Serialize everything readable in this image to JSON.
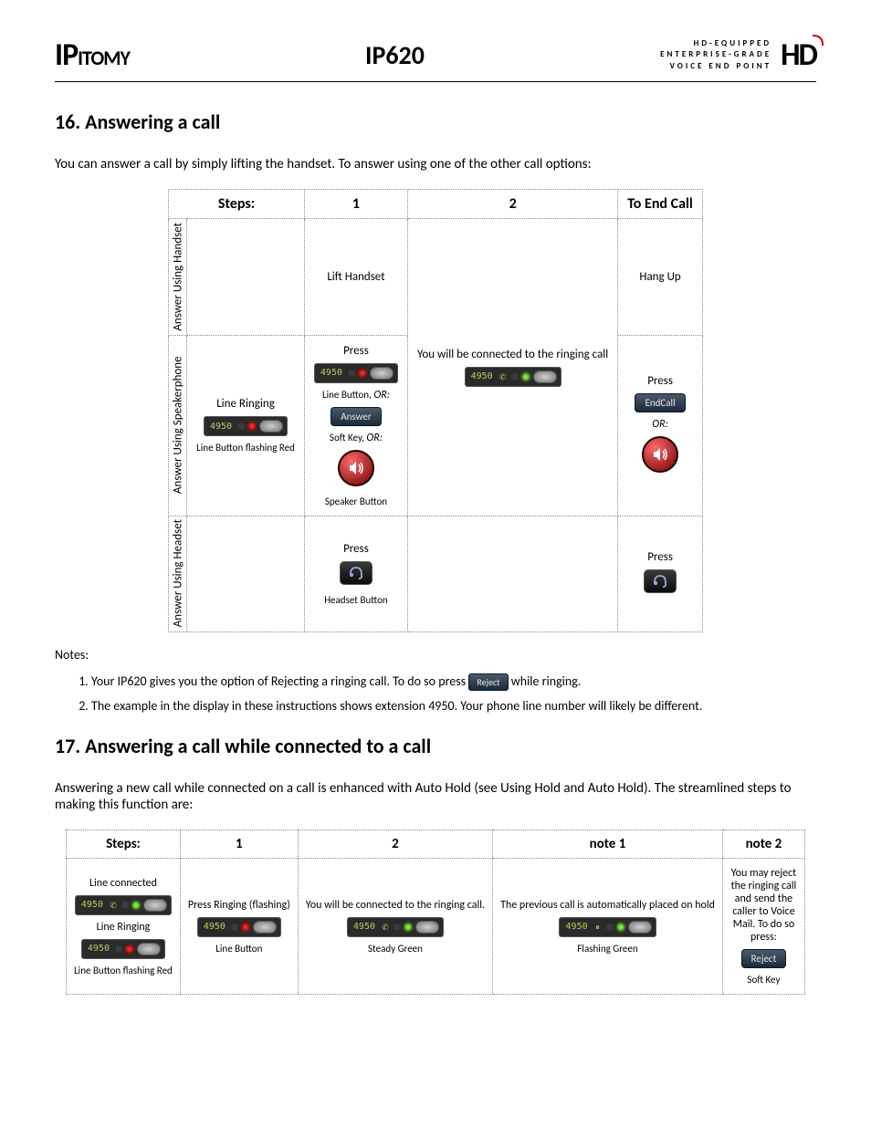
{
  "header": {
    "logo_left": "IPITOMY",
    "model": "IP620",
    "tagline_l1": "HD-EQUIPPED",
    "tagline_l2": "ENTERPRISE-GRADE",
    "tagline_l3": "VOICE END POINT",
    "logo_right": "HD"
  },
  "section16": {
    "heading": "16. Answering a call",
    "intro": "You can answer a call by simply lifting the handset. To answer using one of the other call options:",
    "table": {
      "col_steps": "Steps:",
      "col_1": "1",
      "col_2": "2",
      "col_end": "To End Call",
      "row_handset_label": "Answer Using Handset",
      "row_speaker_label": "Answer Using Speakerphone",
      "row_headset_label": "Answer Using Headset",
      "handset_s1": "Lift Handset",
      "handset_end": "Hang Up",
      "speaker_steps_title": "Line Ringing",
      "ext_num": "4950",
      "line_flashing_red": "Line Button flashing Red",
      "press": "Press",
      "line_button_or": "Line Button,",
      "or": "OR:",
      "answer_key": "Answer",
      "softkey_or": "Soft Key,",
      "speaker_button": "Speaker Button",
      "connected_text": "You will be connected to the ringing call",
      "endcall_key": "EndCall",
      "headset_button": "Headset Button"
    },
    "notes_label": "Notes:",
    "note1_a": "Your IP620 gives you the option of Rejecting a ringing call. To do so press",
    "note1_key": "Reject",
    "note1_b": "while ringing.",
    "note2": "The example in the display in these instructions shows extension 4950. Your phone line number will likely be different."
  },
  "section17": {
    "heading": "17. Answering a call while connected to a call",
    "intro": "Answering a new call while connected on a call is enhanced with Auto Hold (see Using Hold and Auto Hold). The streamlined steps to making this function are:",
    "table": {
      "col_steps": "Steps:",
      "col_1": "1",
      "col_2": "2",
      "col_n1": "note 1",
      "col_n2": "note 2",
      "line_connected": "Line connected",
      "line_ringing": "Line Ringing",
      "line_flashing_red": "Line Button flashing Red",
      "press_ringing": "Press Ringing (flashing)",
      "line_button": "Line Button",
      "connected_text": "You will be connected to the ringing call.",
      "steady_green": "Steady Green",
      "prev_call": "The previous call is automatically placed on hold",
      "flashing_green": "Flashing Green",
      "reject_text": "You may reject the ringing call and send the caller to Voice Mail. To do so press:",
      "reject_key": "Reject",
      "soft_key": "Soft Key",
      "ext_num": "4950"
    }
  }
}
